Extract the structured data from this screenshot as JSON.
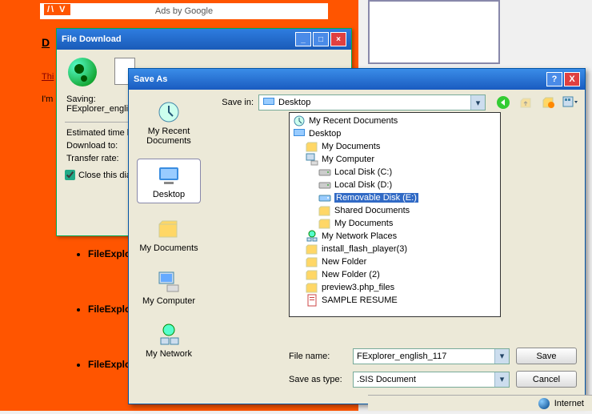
{
  "bg": {
    "ads": "Ads by Google",
    "av": "/\\ V",
    "d": "D",
    "this": "Thi",
    "im": "I'm",
    "list": [
      "FileExplore",
      "FileExplore",
      "FileExplore"
    ]
  },
  "download": {
    "title": "File Download",
    "saving_label": "Saving:",
    "filename": "FExplorer_engli",
    "est_label": "Estimated time l",
    "to_label": "Download to:",
    "rate_label": "Transfer rate:",
    "close_label": "Close this dia"
  },
  "saveas": {
    "title": "Save As",
    "savein_label": "Save in:",
    "savein_value": "Desktop",
    "side": [
      {
        "label": "My Recent Documents"
      },
      {
        "label": "Desktop"
      },
      {
        "label": "My Documents"
      },
      {
        "label": "My Computer"
      },
      {
        "label": "My Network"
      }
    ],
    "tree": [
      {
        "label": "My Recent Documents",
        "ico": "recent",
        "ind": 0
      },
      {
        "label": "Desktop",
        "ico": "desktop",
        "ind": 0
      },
      {
        "label": "My Documents",
        "ico": "folder",
        "ind": 1
      },
      {
        "label": "My Computer",
        "ico": "computer",
        "ind": 1
      },
      {
        "label": "Local Disk (C:)",
        "ico": "disk",
        "ind": 2
      },
      {
        "label": "Local Disk (D:)",
        "ico": "disk",
        "ind": 2
      },
      {
        "label": "Removable Disk (E:)",
        "ico": "remdisk",
        "ind": 2,
        "sel": true
      },
      {
        "label": "Shared Documents",
        "ico": "folder",
        "ind": 2
      },
      {
        "label": "My Documents",
        "ico": "folder",
        "ind": 2
      },
      {
        "label": "My Network Places",
        "ico": "network",
        "ind": 1
      },
      {
        "label": "install_flash_player(3)",
        "ico": "folder",
        "ind": 1
      },
      {
        "label": "New Folder",
        "ico": "folder",
        "ind": 1
      },
      {
        "label": "New Folder (2)",
        "ico": "folder",
        "ind": 1
      },
      {
        "label": "preview3.php_files",
        "ico": "folder",
        "ind": 1
      },
      {
        "label": "SAMPLE RESUME",
        "ico": "file",
        "ind": 1
      }
    ],
    "filename_label": "File name:",
    "filename_value": "FExplorer_english_117",
    "type_label": "Save as type:",
    "type_value": ".SIS Document",
    "save_btn": "Save",
    "cancel_btn": "Cancel"
  },
  "status": {
    "internet": "Internet"
  }
}
